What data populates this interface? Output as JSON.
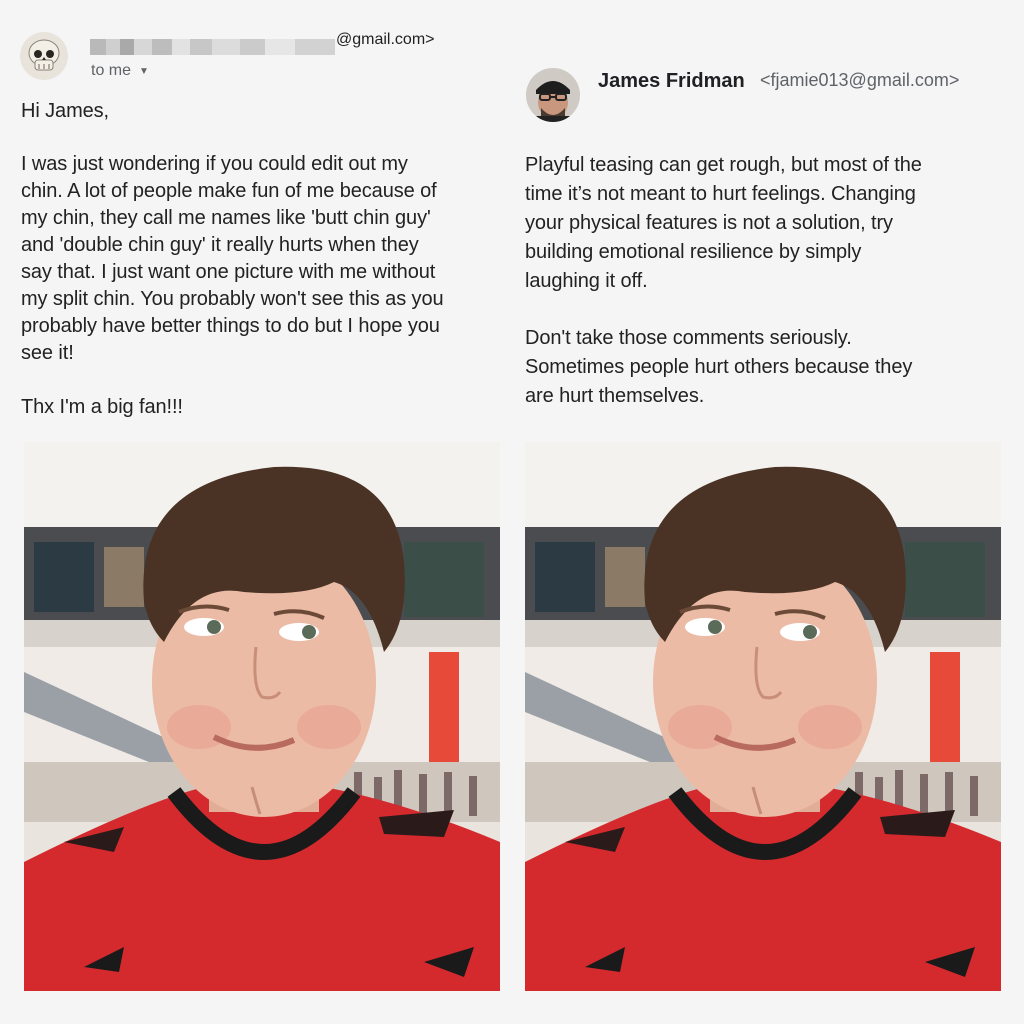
{
  "left": {
    "sender_domain": "@gmail.com>",
    "recipient_label": "to me",
    "greeting": "Hi James,",
    "body_lines": [
      "I was just wondering if you could edit out my",
      "chin. A lot of people make fun of me because of",
      "my chin, they call me names like 'butt chin guy'",
      "and 'double chin guy' it really hurts when they",
      "say that. I just want one picture with me without",
      "my split chin. You probably won't see this as you",
      "probably have better things to do but I hope you",
      "see it!"
    ],
    "signoff": "Thx I'm a big fan!!!",
    "avatar_icon": "skull-avatar-icon"
  },
  "right": {
    "sender_name": "James Fridman",
    "sender_email": "<fjamie013@gmail.com>",
    "para1_lines": [
      "Playful teasing can get rough, but most of the",
      "time it’s not meant to hurt feelings. Changing",
      "your physical features is not a solution, try",
      "building emotional resilience by simply",
      "laughing it off."
    ],
    "para2_lines": [
      "Don't take those comments seriously.",
      "Sometimes people hurt others because they",
      "are hurt themselves."
    ],
    "avatar_icon": "man-with-cap-avatar-icon"
  },
  "colors": {
    "shirt_red": "#d42a2e",
    "hair_brown": "#4a3325",
    "skin": "#e9b9a3"
  }
}
